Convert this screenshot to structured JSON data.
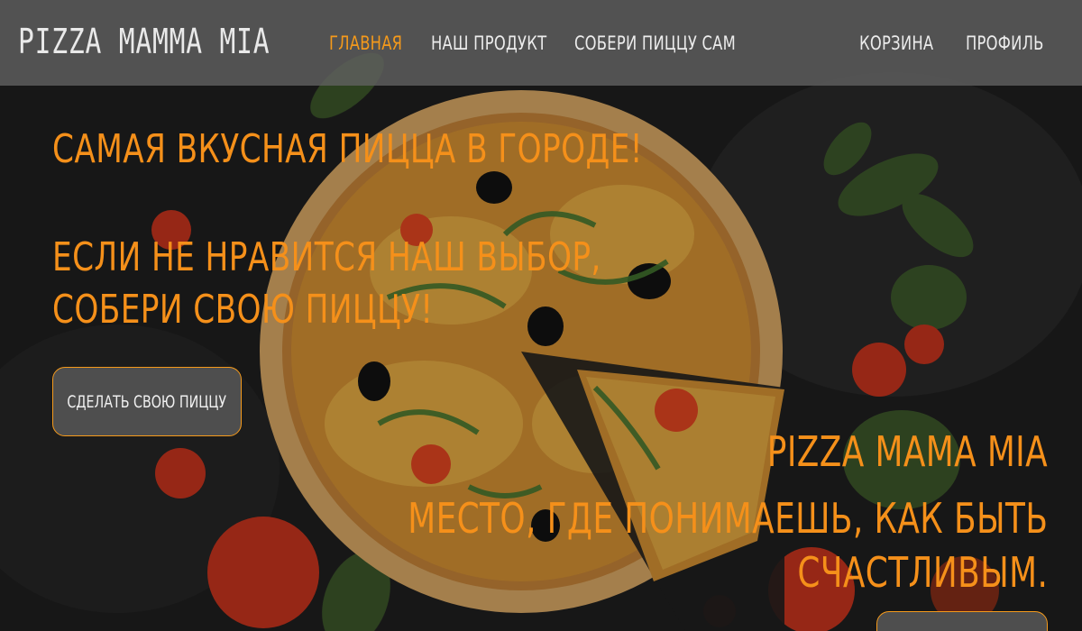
{
  "header": {
    "logo": "PIZZA MAMMA MIA",
    "nav": {
      "home": "ГЛАВНАЯ",
      "product": "НАШ ПРОДУКТ",
      "build": "СОБЕРИ ПИЦЦУ САМ",
      "cart": "КОРЗИНА",
      "profile": "ПРОФИЛЬ"
    }
  },
  "hero": {
    "headline": "САМАЯ ВКУСНАЯ ПИЦЦА В ГОРОДЕ!",
    "sub_line1": "ЕСЛИ НЕ НРАВИТСЯ НАШ ВЫБОР,",
    "sub_line2": "СОБЕРИ СВОЮ ПИЦЦУ!",
    "cta_label": "СДЕЛАТЬ СВОЮ ПИЦЦУ",
    "brand": "PIZZA MAMA MIA",
    "tagline_line1": "МЕСТО, ГДЕ ПОНИМАЕШЬ, КАК БЫТЬ",
    "tagline_line2": "СЧАСТЛИВЫМ."
  },
  "colors": {
    "accent": "#f5901a",
    "header_bg": "#5f5f5f",
    "background": "#1a1a1a"
  }
}
